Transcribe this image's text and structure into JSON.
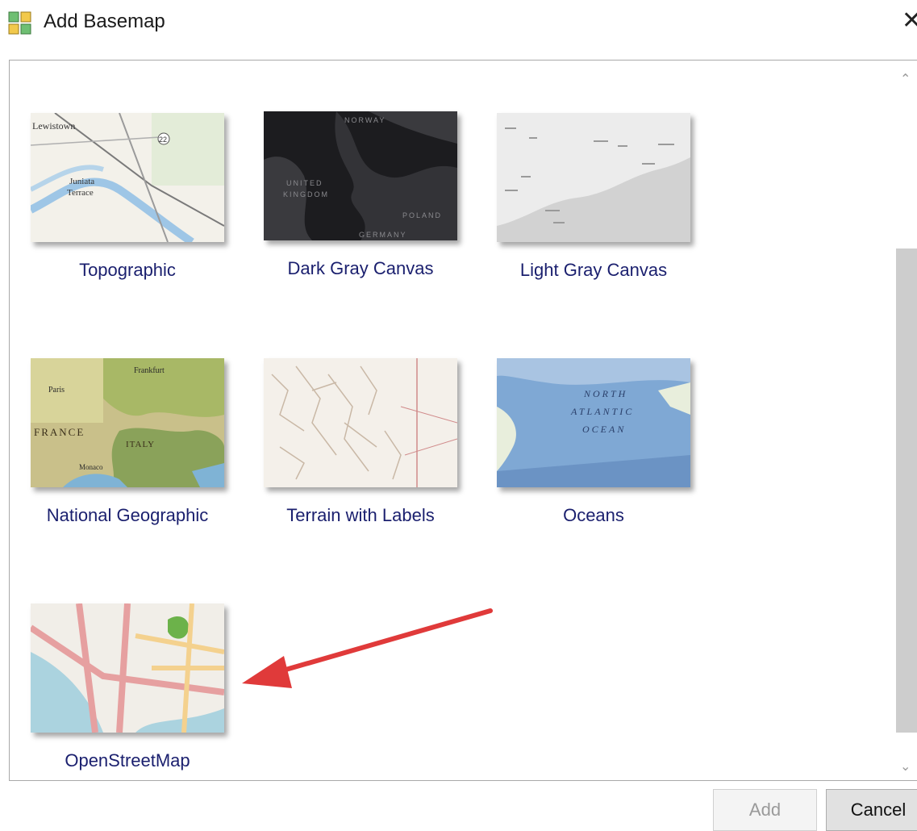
{
  "window": {
    "title": "Add Basemap",
    "close_glyph": "✕"
  },
  "gallery": {
    "items": [
      {
        "label": "Topographic",
        "thumb_icon": "topographic-map-icon"
      },
      {
        "label": "Dark Gray Canvas",
        "thumb_icon": "dark-gray-map-icon"
      },
      {
        "label": "Light Gray Canvas",
        "thumb_icon": "light-gray-map-icon"
      },
      {
        "label": "National Geographic",
        "thumb_icon": "national-geographic-map-icon"
      },
      {
        "label": "Terrain with Labels",
        "thumb_icon": "terrain-map-icon"
      },
      {
        "label": "Oceans",
        "thumb_icon": "oceans-map-icon"
      },
      {
        "label": "OpenStreetMap",
        "thumb_icon": "openstreetmap-map-icon"
      }
    ]
  },
  "thumbs": {
    "topographic": {
      "t1": "Lewistown",
      "t2": "Juniata",
      "t3": "Terrace",
      "t4": "22"
    },
    "dark": {
      "t1": "NORWAY",
      "t2": "UNITED",
      "t3": "KINGDOM",
      "t4": "POLAND",
      "t5": "GERMANY"
    },
    "natgeo": {
      "t1": "FRANCE",
      "t2": "ITALY",
      "t3": "Frankfurt",
      "t4": "Paris",
      "t5": "Monaco"
    },
    "oceans": {
      "t1": "NORTH",
      "t2": "ATLANTIC",
      "t3": "OCEAN"
    }
  },
  "buttons": {
    "add": "Add",
    "cancel": "Cancel"
  },
  "colors": {
    "label_text": "#1a1f6e",
    "annotation_arrow": "#e03a3a"
  }
}
